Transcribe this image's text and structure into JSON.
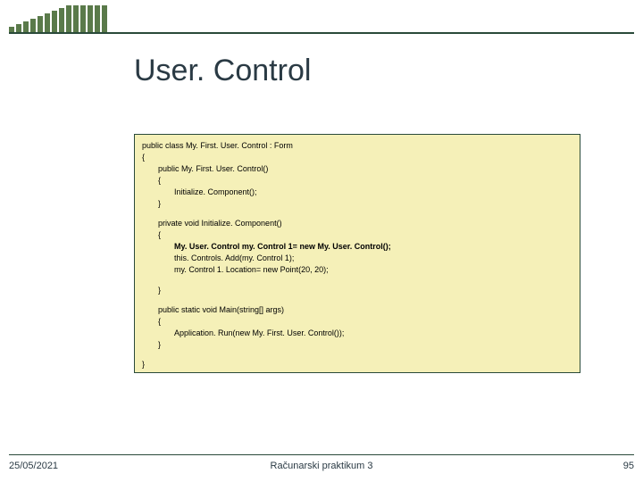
{
  "title": "User. Control",
  "code": {
    "l1": "public class My. First. User. Control : Form",
    "l2": "{",
    "l3": "public My. First. User. Control()",
    "l4": "{",
    "l5": "Initialize. Component();",
    "l6": "}",
    "l7": "private void Initialize. Component()",
    "l8": "{",
    "l9": "My. User. Control my. Control 1= new My. User. Control();",
    "l10": "this. Controls. Add(my. Control 1);",
    "l11": "my. Control 1. Location= new Point(20, 20);",
    "l12": "}",
    "l13": "public static void Main(string[] args)",
    "l14": "{",
    "l15": "Application. Run(new My. First. User. Control());",
    "l16": "}",
    "l17": "}"
  },
  "footer": {
    "date": "25/05/2021",
    "center": "Računarski praktikum 3",
    "page": "95"
  },
  "bars": [
    6,
    9,
    12,
    15,
    18,
    21,
    24,
    27,
    30,
    30,
    30,
    30,
    30,
    30
  ]
}
